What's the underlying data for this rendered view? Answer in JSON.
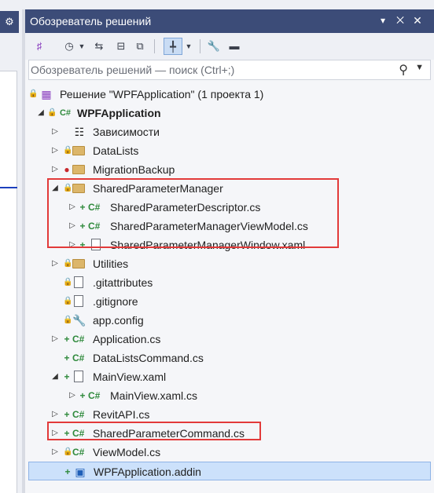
{
  "left_strip": {
    "gear_icon": "gear-icon"
  },
  "panel": {
    "title": "Обозреватель решений",
    "buttons": [
      "chevron-down-icon",
      "pin-icon",
      "close-icon"
    ]
  },
  "search": {
    "placeholder": "Обозреватель решений — поиск (Ctrl+;)"
  },
  "tree": {
    "items": [
      {
        "label": "Решение \"WPFApplication\"  (1 проекта 1)",
        "icon": "solution-icon"
      },
      {
        "label": "WPFApplication",
        "icon": "csharp-project-icon"
      },
      {
        "label": "Зависимости",
        "icon": "dependencies-icon"
      },
      {
        "label": "DataLists",
        "icon": "folder-icon"
      },
      {
        "label": "MigrationBackup",
        "icon": "folder-icon"
      },
      {
        "label": "SharedParameterManager",
        "icon": "folder-icon"
      },
      {
        "label": "SharedParameterDescriptor.cs",
        "icon": "csharp-file-icon"
      },
      {
        "label": "SharedParameterManagerViewModel.cs",
        "icon": "csharp-file-icon"
      },
      {
        "label": "SharedParameterManagerWindow.xaml",
        "icon": "xaml-file-icon"
      },
      {
        "label": "Utilities",
        "icon": "folder-icon"
      },
      {
        "label": ".gitattributes",
        "icon": "file-icon"
      },
      {
        "label": ".gitignore",
        "icon": "file-icon"
      },
      {
        "label": "app.config",
        "icon": "config-file-icon"
      },
      {
        "label": "Application.cs",
        "icon": "csharp-file-icon"
      },
      {
        "label": "DataListsCommand.cs",
        "icon": "csharp-file-icon"
      },
      {
        "label": "MainView.xaml",
        "icon": "xaml-file-icon"
      },
      {
        "label": "MainView.xaml.cs",
        "icon": "csharp-file-icon"
      },
      {
        "label": "RevitAPI.cs",
        "icon": "csharp-file-icon"
      },
      {
        "label": "SharedParameterCommand.cs",
        "icon": "csharp-file-icon"
      },
      {
        "label": "ViewModel.cs",
        "icon": "csharp-file-icon"
      },
      {
        "label": "WPFApplication.addin",
        "icon": "addin-file-icon"
      }
    ]
  },
  "colors": {
    "title_bar": "#3c4c78",
    "highlight_box": "#e23a3a",
    "selection": "#cce1fb"
  }
}
